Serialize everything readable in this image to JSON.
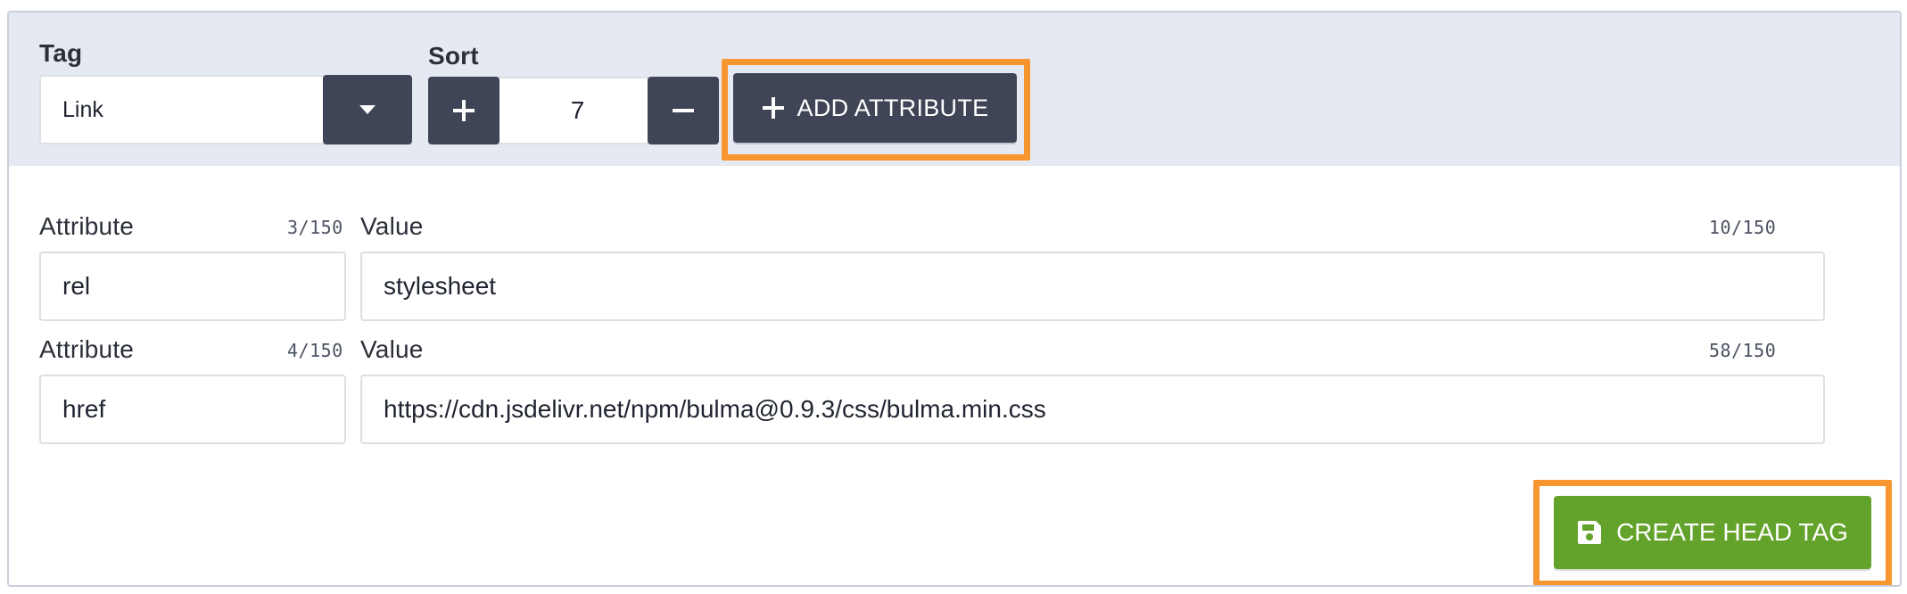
{
  "tag": {
    "label": "Tag",
    "value": "Link"
  },
  "sort": {
    "label": "Sort",
    "value": "7"
  },
  "add_attribute": {
    "label": "ADD ATTRIBUTE"
  },
  "attributes": [
    {
      "attribute_label": "Attribute",
      "attribute_counter": "3/150",
      "attribute_value": "rel",
      "value_label": "Value",
      "value_counter": "10/150",
      "value_value": "stylesheet"
    },
    {
      "attribute_label": "Attribute",
      "attribute_counter": "4/150",
      "attribute_value": "href",
      "value_label": "Value",
      "value_counter": "58/150",
      "value_value": "https://cdn.jsdelivr.net/npm/bulma@0.9.3/css/bulma.min.css"
    }
  ],
  "create": {
    "label": "CREATE HEAD TAG"
  },
  "colors": {
    "band": "#e5e9f2",
    "dark_button": "#3f4556",
    "primary_green": "#64a32b",
    "highlight_orange": "#f7962f"
  },
  "icons": {
    "dropdown": "caret-down-icon",
    "increment": "plus-icon",
    "decrement": "minus-icon",
    "add": "plus-icon",
    "save": "save-icon"
  }
}
